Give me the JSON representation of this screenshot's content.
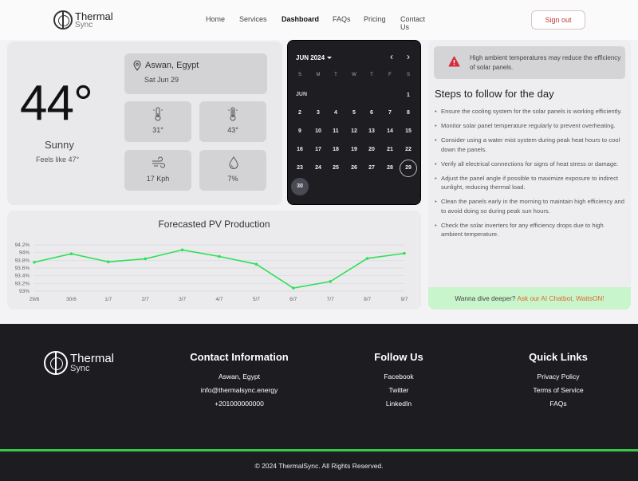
{
  "nav": {
    "logo_line1": "Thermal",
    "logo_line2": "Sync",
    "links": [
      "Home",
      "Services",
      "Dashboard",
      "FAQs",
      "Pricing",
      "Contact Us"
    ],
    "active_link": "Dashboard",
    "signout_label": "Sign out"
  },
  "weather": {
    "temperature": "44°",
    "condition": "Sunny",
    "feels_like": "Feels like 47°",
    "location": "Aswan, Egypt",
    "date": "Sat Jun 29",
    "tiles": [
      {
        "icon": "thermometer-low-icon",
        "value": "31°"
      },
      {
        "icon": "thermometer-high-icon",
        "value": "43°"
      },
      {
        "icon": "wind-icon",
        "value": "17 Kph"
      },
      {
        "icon": "humidity-icon",
        "value": "7%"
      }
    ]
  },
  "calendar": {
    "month_label": "JUN 2024",
    "section_label": "JUN",
    "weekdays": [
      "S",
      "M",
      "T",
      "W",
      "T",
      "F",
      "S"
    ],
    "days": [
      "1",
      "2",
      "3",
      "4",
      "5",
      "6",
      "7",
      "8",
      "9",
      "10",
      "11",
      "12",
      "13",
      "14",
      "15",
      "16",
      "17",
      "18",
      "19",
      "20",
      "21",
      "22",
      "23",
      "24",
      "25",
      "26",
      "27",
      "28",
      "29",
      "30"
    ],
    "first_weekday": 6,
    "today": "29",
    "selected": "30"
  },
  "alert": {
    "text": "High ambient temperatures may reduce the efficiency of solar panels."
  },
  "steps": {
    "title": "Steps to follow for the day",
    "items": [
      "Ensure the cooling system for the solar panels is working efficiently.",
      "Monitor solar panel temperature regularly to prevent overheating.",
      "Consider using a water mist system during peak heat hours to cool down the panels.",
      "Verify all electrical connections for signs of heat stress or damage.",
      "Adjust the panel angle if possible to maximize exposure to indirect sunlight, reducing thermal load.",
      "Clean the panels early in the morning to maintain high efficiency and to avoid doing so during peak sun hours.",
      "Check the solar inverters for any efficiency drops due to high ambient temperature."
    ],
    "chat_prefix": "Wanna dive deeper? ",
    "chat_link": "Ask our AI Chatbot, WattsON!"
  },
  "chart_data": {
    "type": "line",
    "title": "Forecasted PV Production",
    "categories": [
      "29/6",
      "30/6",
      "1/7",
      "2/7",
      "3/7",
      "4/7",
      "5/7",
      "6/7",
      "7/7",
      "8/7",
      "9/7"
    ],
    "series": [
      {
        "values": [
          93.75,
          93.97,
          93.76,
          93.84,
          94.07,
          93.9,
          93.7,
          93.08,
          93.25,
          93.85,
          93.98
        ]
      }
    ],
    "yticks": [
      "94.2%",
      "94%",
      "93.8%",
      "93.6%",
      "93.4%",
      "93.2%",
      "93%"
    ],
    "ylim": [
      93,
      94.2
    ],
    "line_color": "#2ee05a",
    "grid": true
  },
  "footer": {
    "logo_line1": "Thermal",
    "logo_line2": "Sync",
    "contact_title": "Contact Information",
    "contact": [
      "Aswan, Egypt",
      "info@thermalsync.energy",
      "+201000000000"
    ],
    "follow_title": "Follow Us",
    "follow": [
      "Facebook",
      "Twitter",
      "LinkedIn"
    ],
    "quick_title": "Quick Links",
    "quick": [
      "Privacy Policy",
      "Terms of Service",
      "FAQs"
    ],
    "copyright": "© 2024 ThermalSync. All Rights Reserved.",
    "accent_color": "#3bc64a"
  }
}
